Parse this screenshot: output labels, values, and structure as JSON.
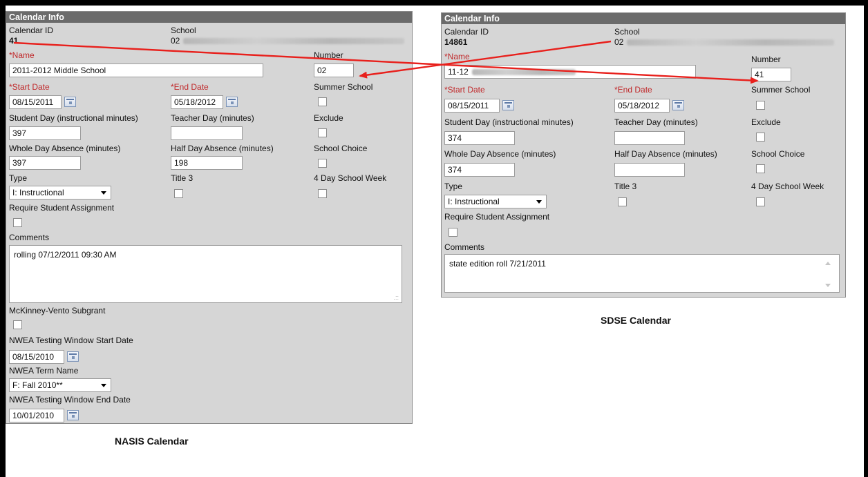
{
  "left": {
    "panel_title": "Calendar Info",
    "calendar_id_label": "Calendar ID",
    "calendar_id_value": "41",
    "school_label": "School",
    "school_prefix": "02",
    "name_label": "*Name",
    "name_value": "2011-2012 Middle School",
    "number_label": "Number",
    "number_value": "02",
    "start_date_label": "*Start Date",
    "start_date_value": "08/15/2011",
    "end_date_label": "*End Date",
    "end_date_value": "05/18/2012",
    "summer_school_label": "Summer School",
    "student_day_label": "Student Day (instructional minutes)",
    "student_day_value": "397",
    "teacher_day_label": "Teacher Day (minutes)",
    "exclude_label": "Exclude",
    "whole_day_label": "Whole Day Absence (minutes)",
    "whole_day_value": "397",
    "half_day_label": "Half Day Absence (minutes)",
    "half_day_value": "198",
    "school_choice_label": "School Choice",
    "type_label": "Type",
    "type_value": "I: Instructional",
    "title3_label": "Title 3",
    "four_day_label": "4 Day School Week",
    "require_label": "Require Student Assignment",
    "comments_label": "Comments",
    "comments_value": "rolling 07/12/2011 09:30 AM",
    "mckinney_label": "McKinney-Vento Subgrant",
    "nwea_start_label": "NWEA Testing Window Start Date",
    "nwea_start_value": "08/15/2010",
    "nwea_term_label": "NWEA Term Name",
    "nwea_term_value": "F: Fall 2010**",
    "nwea_end_label": "NWEA Testing Window End Date",
    "nwea_end_value": "10/01/2010",
    "caption": "NASIS Calendar"
  },
  "right": {
    "panel_title": "Calendar Info",
    "calendar_id_label": "Calendar ID",
    "calendar_id_value": "14861",
    "school_label": "School",
    "school_prefix": "02",
    "name_label": "*Name",
    "name_prefix": "11-12",
    "number_label": "Number",
    "number_value": "41",
    "start_date_label": "*Start Date",
    "start_date_value": "08/15/2011",
    "end_date_label": "*End Date",
    "end_date_value": "05/18/2012",
    "summer_school_label": "Summer School",
    "student_day_label": "Student Day (instructional minutes)",
    "student_day_value": "374",
    "teacher_day_label": "Teacher Day (minutes)",
    "exclude_label": "Exclude",
    "whole_day_label": "Whole Day Absence (minutes)",
    "whole_day_value": "374",
    "half_day_label": "Half Day Absence (minutes)",
    "school_choice_label": "School Choice",
    "type_label": "Type",
    "type_value": "I: Instructional",
    "title3_label": "Title 3",
    "four_day_label": "4 Day School Week",
    "require_label": "Require Student Assignment",
    "comments_label": "Comments",
    "comments_value": "state edition roll 7/21/2011",
    "caption": "SDSE Calendar"
  },
  "colors": {
    "panel_bg": "#d6d6d6",
    "title_bar": "#6b6b6b",
    "required_label": "#c0282a",
    "annotation_arrow": "#e8201c"
  }
}
